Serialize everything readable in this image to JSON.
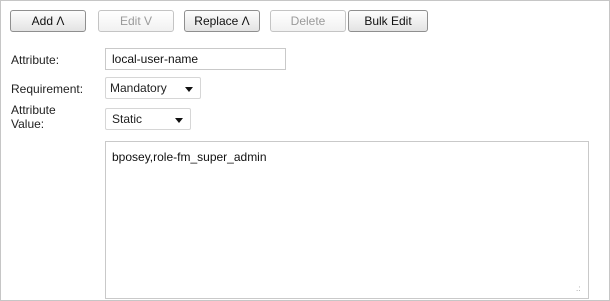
{
  "toolbar": {
    "add_label": "Add Λ",
    "edit_label": "Edit V",
    "replace_label": "Replace Λ",
    "delete_label": "Delete",
    "bulk_edit_label": "Bulk Edit"
  },
  "form": {
    "attribute_label": "Attribute:",
    "attribute_value": "local-user-name",
    "requirement_label": "Requirement:",
    "requirement_selected": "Mandatory",
    "attribute_value_label_line1": "Attribute",
    "attribute_value_label_line2": "Value:",
    "value_type_selected": "Static",
    "value_text": "bposey,role-fm_super_admin"
  }
}
